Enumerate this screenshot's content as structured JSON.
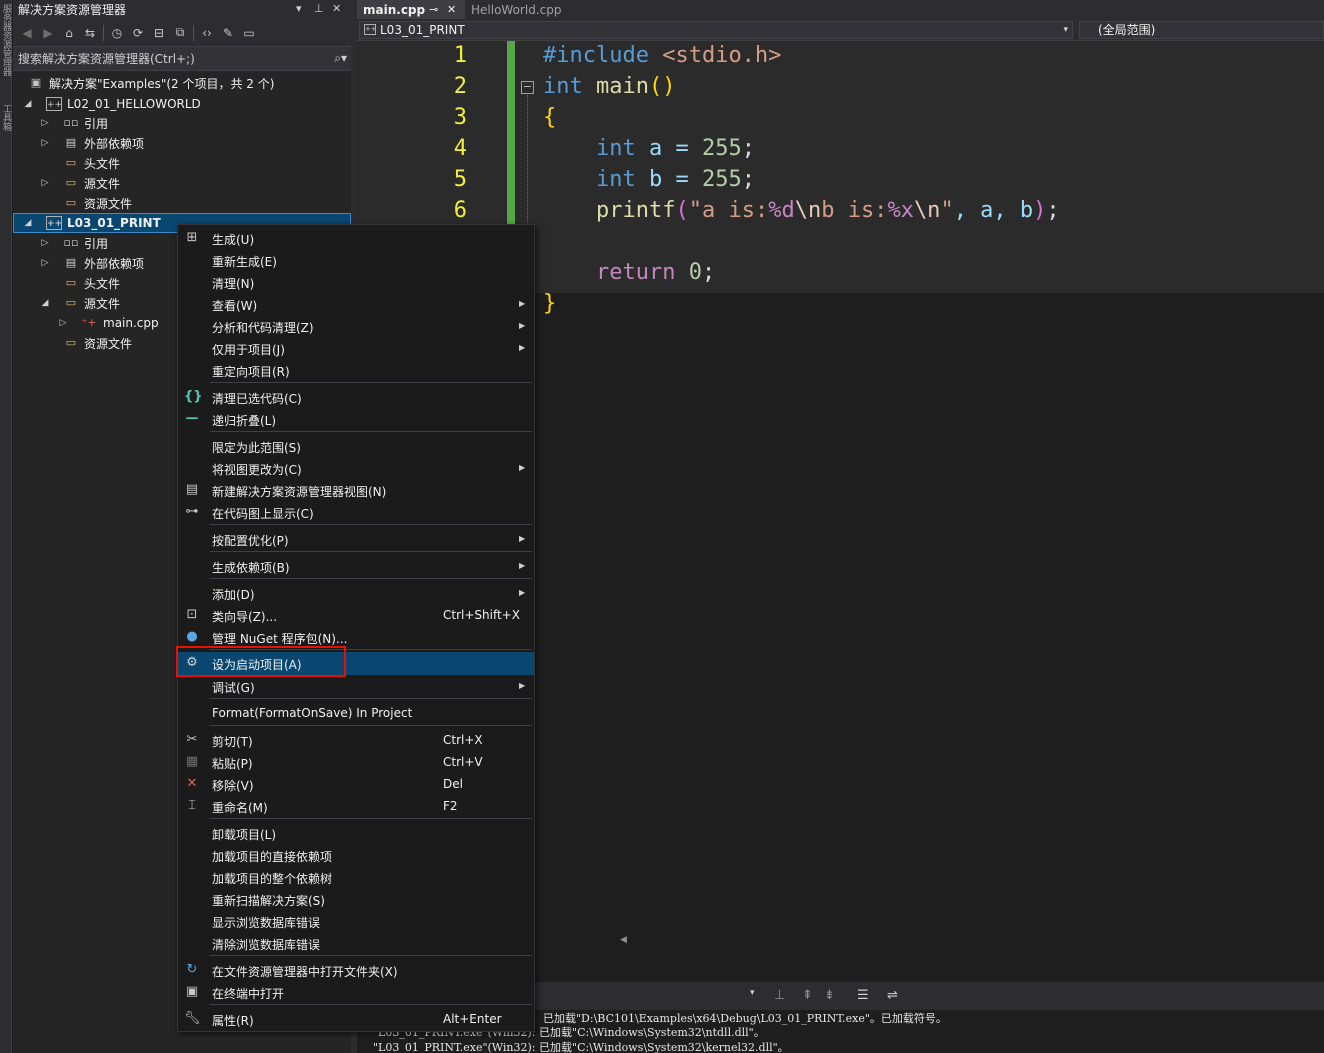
{
  "left_strip": {
    "tabs": [
      "服务器资源管理器",
      "工具箱"
    ]
  },
  "solution_explorer": {
    "title": "解决方案资源管理器",
    "pin_label": "▾ ⊥ ✕",
    "search_placeholder": "搜索解决方案资源管理器(Ctrl+;)",
    "tree": [
      {
        "label": "解决方案\"Examples\"(2 个项目，共 2 个)",
        "level": 0,
        "icon": "solution-icon"
      },
      {
        "label": "L02_01_HELLOWORLD",
        "level": 1,
        "icon": "project-icon",
        "expanded": true
      },
      {
        "label": "引用",
        "level": 2,
        "icon": "references-icon"
      },
      {
        "label": "外部依赖项",
        "level": 2,
        "icon": "external-deps-icon"
      },
      {
        "label": "头文件",
        "level": 2,
        "icon": "folder-icon"
      },
      {
        "label": "源文件",
        "level": 2,
        "icon": "folder-icon"
      },
      {
        "label": "资源文件",
        "level": 2,
        "icon": "folder-icon"
      },
      {
        "label": "L03_01_PRINT",
        "level": 1,
        "icon": "project-icon",
        "selected": true
      },
      {
        "label": "引用",
        "level": 2,
        "icon": "references-icon"
      },
      {
        "label": "外部依赖项",
        "level": 2,
        "icon": "external-deps-icon"
      },
      {
        "label": "头文件",
        "level": 2,
        "icon": "folder-icon"
      },
      {
        "label": "源文件",
        "level": 2,
        "icon": "folder-icon"
      },
      {
        "label": "main.cpp",
        "level": 3,
        "icon": "cpp-file-icon"
      },
      {
        "label": "资源文件",
        "level": 2,
        "icon": "folder-icon"
      }
    ]
  },
  "editor": {
    "tabs": [
      {
        "label": "main.cpp",
        "active": true
      },
      {
        "label": "HelloWorld.cpp",
        "active": false
      }
    ],
    "nav_project": "L03_01_PRINT",
    "nav_scope": "(全局范围)",
    "line_numbers": [
      "1",
      "2",
      "3",
      "4",
      "5",
      "6"
    ],
    "code": {
      "l1_directive": "#include",
      "l1_header": " <stdio.h>",
      "l2_kw": "int",
      "l2_fn": " main",
      "l2_parens": "()",
      "l3_brace": "{",
      "l4_kw": "int",
      "l4_rest": " a = ",
      "l4_num": "255",
      "l4_end": ";",
      "l5_kw": "int",
      "l5_rest": " b = ",
      "l5_num": "255",
      "l5_end": ";",
      "l6_fn": "printf",
      "l6_open": "(",
      "l6_s1": "\"a is:",
      "l6_f1": "%d",
      "l6_e1": "\\n",
      "l6_s2": "b is:",
      "l6_f2": "%x",
      "l6_e2": "\\n",
      "l6_s3": "\"",
      "l6_args": ", a, b",
      "l6_close": ")",
      "l6_end": ";",
      "l8_kw": "return",
      "l8_num": " 0",
      "l8_end": ";",
      "l9_brace": "}"
    }
  },
  "output": {
    "lines": [
      "已加载\"D:\\BC101\\Examples\\x64\\Debug\\L03_01_PRINT.exe\"。已加载符号。",
      "\"L03_01_PRINT.exe\"(Win32): 已加载\"C:\\Windows\\System32\\ntdll.dll\"。",
      "\"L03_01_PRINT.exe\"(Win32): 已加载\"C:\\Windows\\System32\\kernel32.dll\"。"
    ]
  },
  "context_menu": {
    "items": [
      {
        "label": "生成(U)",
        "icon": "build-icon"
      },
      {
        "label": "重新生成(E)"
      },
      {
        "label": "清理(N)"
      },
      {
        "label": "查看(W)",
        "submenu": true
      },
      {
        "label": "分析和代码清理(Z)",
        "submenu": true
      },
      {
        "label": "仅用于项目(J)",
        "submenu": true
      },
      {
        "label": "重定向项目(R)"
      },
      {
        "label": "清理已选代码(C)",
        "icon": "braces-icon"
      },
      {
        "label": "递归折叠(L)",
        "icon": "collapse-icon"
      },
      {
        "label": "限定为此范围(S)"
      },
      {
        "label": "将视图更改为(C)",
        "submenu": true
      },
      {
        "label": "新建解决方案资源管理器视图(N)",
        "icon": "new-view-icon"
      },
      {
        "label": "在代码图上显示(C)",
        "icon": "code-map-icon"
      },
      {
        "label": "按配置优化(P)",
        "submenu": true
      },
      {
        "label": "生成依赖项(B)",
        "submenu": true
      },
      {
        "label": "添加(D)",
        "submenu": true
      },
      {
        "label": "类向导(Z)...",
        "shortcut": "Ctrl+Shift+X",
        "icon": "class-wizard-icon"
      },
      {
        "label": "管理 NuGet 程序包(N)...",
        "icon": "nuget-icon"
      },
      {
        "label": "设为启动项目(A)",
        "icon": "gear-icon",
        "highlighted": true
      },
      {
        "label": "调试(G)",
        "submenu": true
      },
      {
        "label": "Format(FormatOnSave) In Project"
      },
      {
        "label": "剪切(T)",
        "shortcut": "Ctrl+X",
        "icon": "scissors-icon"
      },
      {
        "label": "粘贴(P)",
        "shortcut": "Ctrl+V",
        "icon": "paste-icon"
      },
      {
        "label": "移除(V)",
        "shortcut": "Del",
        "icon": "remove-icon"
      },
      {
        "label": "重命名(M)",
        "shortcut": "F2",
        "icon": "rename-icon"
      },
      {
        "label": "卸载项目(L)"
      },
      {
        "label": "加载项目的直接依赖项"
      },
      {
        "label": "加载项目的整个依赖树"
      },
      {
        "label": "重新扫描解决方案(S)"
      },
      {
        "label": "显示浏览数据库错误"
      },
      {
        "label": "清除浏览数据库错误"
      },
      {
        "label": "在文件资源管理器中打开文件夹(X)",
        "icon": "open-folder-icon"
      },
      {
        "label": "在终端中打开",
        "icon": "terminal-icon"
      },
      {
        "label": "属性(R)",
        "shortcut": "Alt+Enter",
        "icon": "wrench-icon"
      }
    ]
  },
  "colors": {
    "accent": "#094771",
    "highlight_border": "#e51400",
    "change_bar": "#57a64a"
  }
}
